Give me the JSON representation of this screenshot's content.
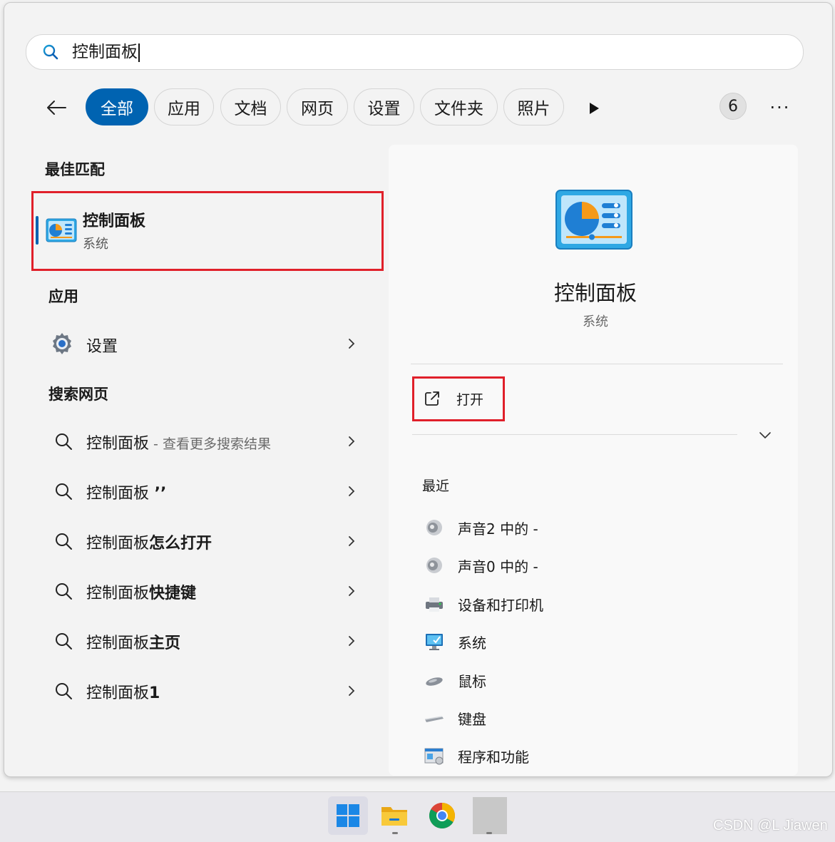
{
  "search": {
    "query": "控制面板"
  },
  "filters": {
    "tabs": [
      {
        "label": "全部",
        "active": true
      },
      {
        "label": "应用"
      },
      {
        "label": "文档"
      },
      {
        "label": "网页"
      },
      {
        "label": "设置"
      },
      {
        "label": "文件夹"
      },
      {
        "label": "照片"
      }
    ],
    "badge_count": "6",
    "more_label": "···"
  },
  "best_match": {
    "heading": "最佳匹配",
    "title": "控制面板",
    "subtitle": "系统",
    "icon": "control-panel-icon"
  },
  "apps": {
    "heading": "应用",
    "items": [
      {
        "label": "设置",
        "icon": "gear-icon"
      }
    ]
  },
  "web": {
    "heading": "搜索网页",
    "items": [
      {
        "prefix": "控制面板",
        "suffix": " - 查看更多搜索结果",
        "suffix_style": "muted"
      },
      {
        "prefix": "控制面板",
        "suffix": " ’’",
        "suffix_style": "bold"
      },
      {
        "prefix": "控制面板",
        "suffix": "怎么打开",
        "suffix_style": "bold"
      },
      {
        "prefix": "控制面板",
        "suffix": "快捷键",
        "suffix_style": "bold"
      },
      {
        "prefix": "控制面板",
        "suffix": "主页",
        "suffix_style": "bold"
      },
      {
        "prefix": "控制面板",
        "suffix": "1",
        "suffix_style": "bold"
      }
    ]
  },
  "detail": {
    "title": "控制面板",
    "subtitle": "系统",
    "open_label": "打开",
    "recent_heading": "最近",
    "recent": [
      {
        "label": "声音2 中的 -",
        "icon": "speaker-icon"
      },
      {
        "label": "声音0 中的 -",
        "icon": "speaker-icon"
      },
      {
        "label": "设备和打印机",
        "icon": "printer-icon"
      },
      {
        "label": "系统",
        "icon": "monitor-icon"
      },
      {
        "label": "鼠标",
        "icon": "mouse-icon"
      },
      {
        "label": "键盘",
        "icon": "keyboard-icon"
      },
      {
        "label": "程序和功能",
        "icon": "programs-icon"
      }
    ]
  },
  "taskbar": {
    "items": [
      "start-icon",
      "file-explorer-icon",
      "chrome-icon",
      "blank-app-icon"
    ]
  },
  "watermark": "CSDN @L Jiawen",
  "colors": {
    "accent": "#0063b1",
    "highlight_border": "#e0202a"
  }
}
